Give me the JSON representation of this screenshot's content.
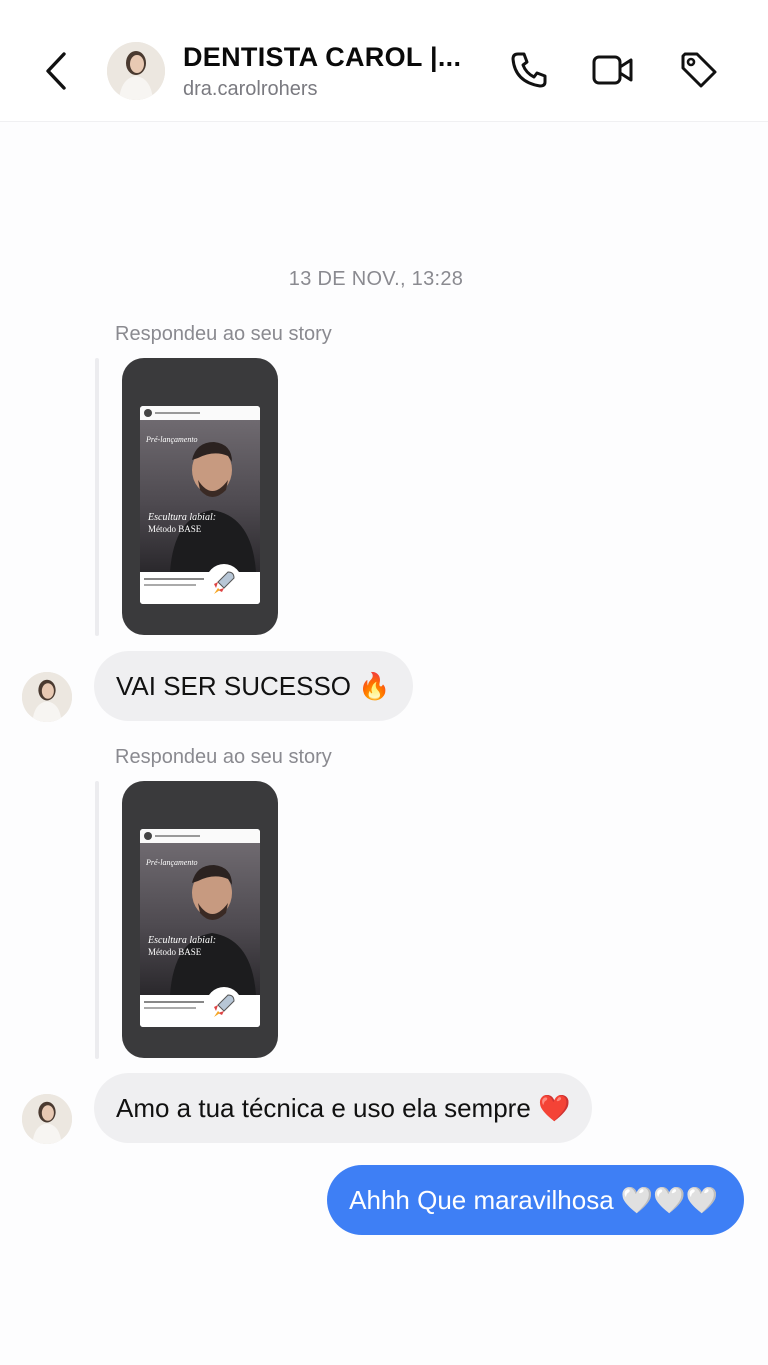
{
  "header": {
    "name": "DENTISTA CAROL |...",
    "handle": "dra.carolrohers",
    "icons": [
      "back-chevron-icon",
      "phone-icon",
      "video-camera-icon",
      "tag-icon"
    ]
  },
  "conversation": {
    "timestamp": "13 DE NOV., 13:28",
    "messages": [
      {
        "reply_label": "Respondeu ao seu story",
        "text": "VAI SER SUCESSO 🔥"
      },
      {
        "reply_label": "Respondeu ao seu story",
        "text": "Amo a tua técnica e uso ela sempre ❤️"
      }
    ],
    "sent": {
      "text": "Ahhh Que maravilhosa 🤍🤍🤍"
    }
  },
  "story": {
    "headline": "Escultura labial:",
    "subtitle": "Método BASE",
    "kicker": "Pré-lançamento"
  },
  "colors": {
    "sent_bubble": "#3e7ff5",
    "received_bubble": "#efeff1",
    "meta_text": "#8a8a90"
  }
}
